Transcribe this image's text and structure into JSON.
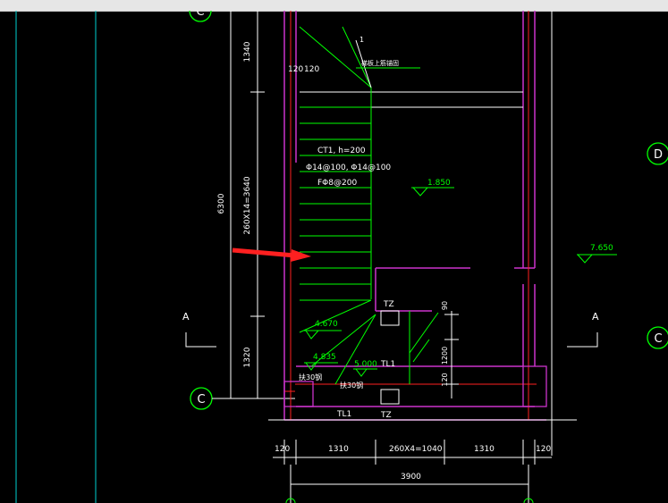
{
  "window": {
    "title_bar": ""
  },
  "colors": {
    "background": "#000000",
    "white": "#ffffff",
    "green": "#00ff00",
    "magenta": "#cc33cc",
    "red": "#ff2020",
    "cyan": "#00d0d0",
    "titlebar": "#e6e6e6"
  },
  "axis_bubbles": {
    "c_left": "C",
    "c_top": "C",
    "d_right": "D",
    "c_right": "C"
  },
  "section_marks": {
    "left": "A",
    "right": "A"
  },
  "dimensions": {
    "left_top": "1340",
    "left_mid": "260X14=3640",
    "left_overall": "6300",
    "left_bottom": "1320",
    "bottom_seg1": "120",
    "bottom_seg2": "1310",
    "bottom_seg3": "260X4=1040",
    "bottom_seg4": "1310",
    "bottom_seg5": "120",
    "bottom_total": "3900",
    "wall_120_a": "120",
    "wall_120_b": "120",
    "right_90": "90",
    "right_1200": "1200",
    "right_120": "120"
  },
  "labels": {
    "stair_note": "CT1, h=200",
    "rebar_note": "Φ14@100, Φ14@100",
    "dist_rebar": "FΦ8@200",
    "elev_landing": "1.850",
    "elev_right": "7.650",
    "elev_4670": "4.670",
    "elev_4835": "4.835",
    "elev_5000": "5.000",
    "tz_top": "TZ",
    "tz_bottom": "TZ",
    "tl1_a": "TL1",
    "tl1_b": "TL1",
    "leader_1": "1",
    "leader_note": "梯板上筋锚固",
    "handrail_a": "扶30钢",
    "handrail_b": "扶30钢"
  }
}
